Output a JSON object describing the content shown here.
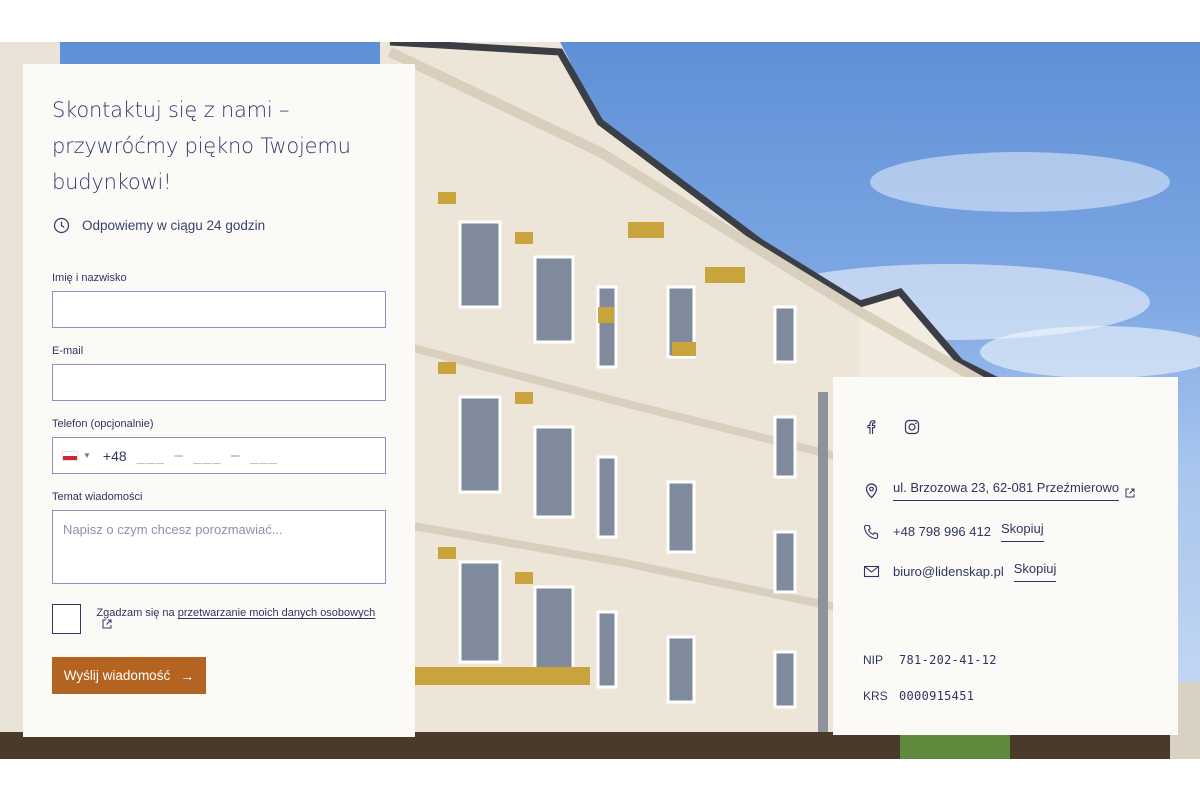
{
  "form": {
    "title": "Skontaktuj się z nami – przywróćmy piękno Twojemu budynkowi!",
    "response_time": "Odpowiemy w ciągu 24 godzin",
    "name_label": "Imię i nazwisko",
    "email_label": "E-mail",
    "phone_label": "Telefon (opcjonalnie)",
    "phone_country": "PL",
    "phone_dial": "+48",
    "phone_mask": "___ – ___ – ___",
    "topic_label": "Temat wiadomości",
    "topic_placeholder": "Napisz o czym chcesz porozmawiać...",
    "consent_prefix": "Zgadzam się na",
    "consent_link": "przetwarzanie moich danych osobowych",
    "send_label": "Wyślij wiadomość",
    "send_arrow": "→"
  },
  "contact": {
    "address": "ul. Brzozowa 23, 62-081 Przeźmierowo",
    "phone": "+48 798 996 412",
    "email": "biuro@lidenskap.pl",
    "copy_label": "Skopiuj",
    "nip_label": "NIP",
    "nip_value": "781-202-41-12",
    "krs_label": "KRS",
    "krs_value": "0000915451"
  },
  "social": [
    "facebook-icon",
    "instagram-icon"
  ],
  "colors": {
    "accent_button": "#b46320",
    "text_navy": "#2f3561",
    "card_bg": "#fcfaf7",
    "input_border": "#8a93bf"
  }
}
